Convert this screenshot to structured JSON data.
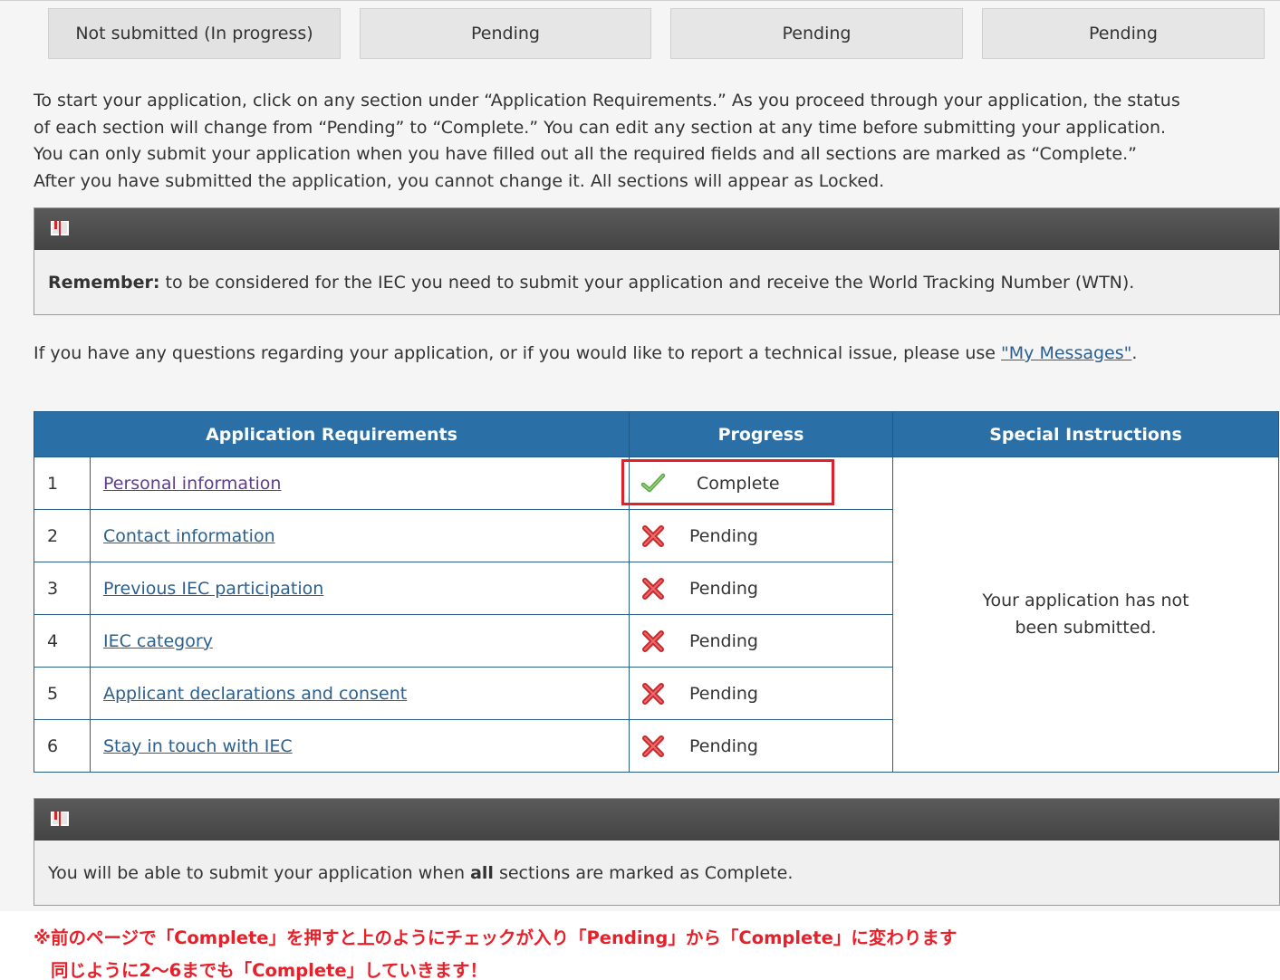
{
  "status_tabs": [
    "Not submitted (In progress)",
    "Pending",
    "Pending",
    "Pending"
  ],
  "intro_lines": [
    "To start your application, click on any section under “Application Requirements.” As you proceed through your application, the status",
    "of each section will change from “Pending” to “Complete.” You can edit any section at any time before submitting your application.",
    "You can only submit your application when you have filled out all the required fields and all sections are marked as “Complete.”",
    "After you have submitted the application, you cannot change it. All sections will appear as Locked."
  ],
  "notice1": {
    "bold": "Remember:",
    "text": " to be considered for the IEC you need to submit your application and receive the World Tracking Number (WTN)."
  },
  "help": {
    "text": "If you have any questions regarding your application, or if you would like to report a technical issue, please use ",
    "link": "\"My Messages\"",
    "end": "."
  },
  "table": {
    "headers": [
      "Application Requirements",
      "Progress",
      "Special Instructions"
    ],
    "rows": [
      {
        "num": "1",
        "name": "Personal information",
        "status": "Complete"
      },
      {
        "num": "2",
        "name": "Contact information",
        "status": "Pending"
      },
      {
        "num": "3",
        "name": "Previous IEC participation",
        "status": "Pending"
      },
      {
        "num": "4",
        "name": "IEC category",
        "status": "Pending"
      },
      {
        "num": "5",
        "name": "Applicant declarations and consent",
        "status": "Pending"
      },
      {
        "num": "6",
        "name": "Stay in touch with IEC",
        "status": "Pending"
      }
    ],
    "special_line1": "Your application has not",
    "special_line2": "been submitted."
  },
  "notice2": {
    "pre": "You will be able to submit your application when ",
    "bold": "all",
    "post": " sections are marked as Complete."
  },
  "jp_note": {
    "line1": "※前のページで「Complete」を押すと上のようにチェックが入り「Pending」から「Complete」に変わります",
    "line2": "同じように2～6までも「Complete」していきます！"
  },
  "colors": {
    "header_blue": "#2a6fa5",
    "highlight_red": "#e0202a",
    "note_red": "#e8202a",
    "link": "#2b5f8f"
  },
  "icons": {
    "notice": "book-icon",
    "complete": "check-icon",
    "pending": "cross-icon"
  }
}
